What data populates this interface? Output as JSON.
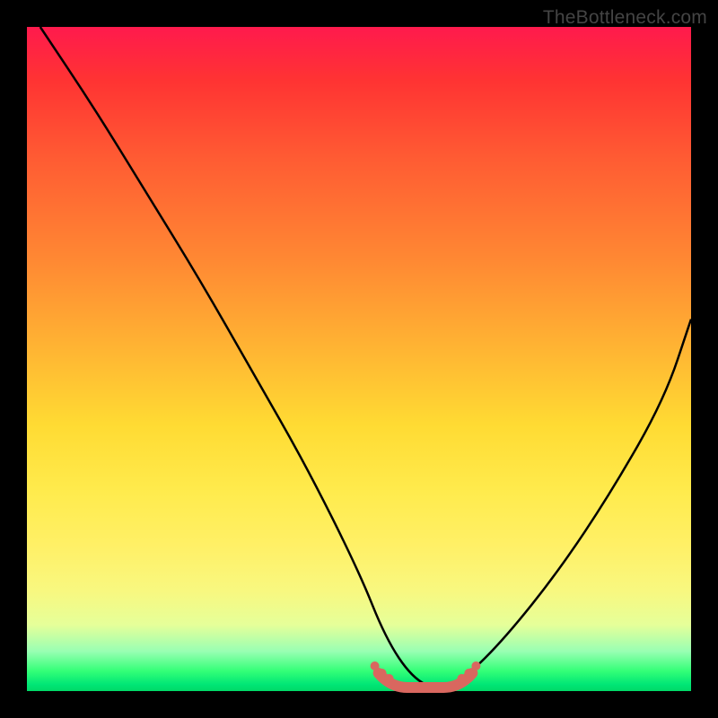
{
  "watermark": "TheBottleneck.com",
  "chart_data": {
    "type": "line",
    "title": "",
    "xlabel": "",
    "ylabel": "",
    "xlim": [
      0,
      100
    ],
    "ylim": [
      0,
      100
    ],
    "grid": false,
    "colors": {
      "gradient_top": "#ff1a4d",
      "gradient_mid": "#ffdb33",
      "gradient_bottom": "#00e676",
      "curve": "#000000",
      "flat_segment": "#d9675f"
    },
    "series": [
      {
        "name": "bottleneck-curve",
        "x": [
          2,
          10,
          18,
          26,
          34,
          42,
          50,
          54,
          58,
          62,
          66,
          72,
          80,
          88,
          96,
          100
        ],
        "values": [
          100,
          88,
          75,
          62,
          48,
          34,
          18,
          8,
          2,
          0,
          2,
          8,
          18,
          30,
          44,
          56
        ]
      }
    ],
    "annotations": [
      {
        "name": "flat-region",
        "x_range": [
          54,
          66
        ],
        "y": 0
      }
    ]
  }
}
